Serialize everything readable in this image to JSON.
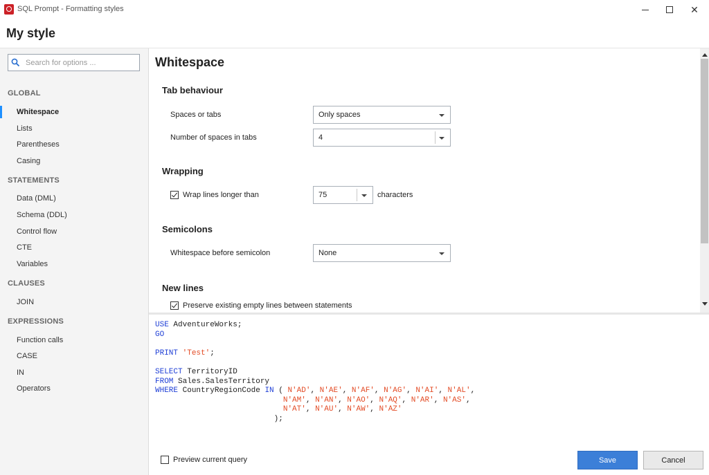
{
  "window": {
    "title": "SQL Prompt - Formatting styles",
    "icon": "sql-prompt-app-icon"
  },
  "header": {
    "style_name": "My style"
  },
  "sidebar": {
    "search_placeholder": "Search for options ...",
    "sections": [
      {
        "label": "GLOBAL",
        "items": [
          "Whitespace",
          "Lists",
          "Parentheses",
          "Casing"
        ]
      },
      {
        "label": "STATEMENTS",
        "items": [
          "Data (DML)",
          "Schema (DDL)",
          "Control flow",
          "CTE",
          "Variables"
        ]
      },
      {
        "label": "CLAUSES",
        "items": [
          "JOIN"
        ]
      },
      {
        "label": "EXPRESSIONS",
        "items": [
          "Function calls",
          "CASE",
          "IN",
          "Operators"
        ]
      }
    ],
    "active_item": "Whitespace"
  },
  "main": {
    "heading": "Whitespace",
    "tab_behaviour": {
      "heading": "Tab behaviour",
      "spaces_or_tabs_label": "Spaces or tabs",
      "spaces_or_tabs_value": "Only spaces",
      "num_spaces_label": "Number of spaces in tabs",
      "num_spaces_value": "4"
    },
    "wrapping": {
      "heading": "Wrapping",
      "wrap_label": "Wrap lines longer than",
      "wrap_checked": true,
      "wrap_value": "75",
      "wrap_suffix": "characters"
    },
    "semicolons": {
      "heading": "Semicolons",
      "label": "Whitespace before semicolon",
      "value": "None"
    },
    "new_lines": {
      "heading": "New lines",
      "preserve_label": "Preserve existing empty lines between statements",
      "preserve_checked": true
    }
  },
  "preview": {
    "lines": [
      [
        {
          "t": "USE",
          "c": "kw"
        },
        {
          "t": " AdventureWorks;",
          "c": ""
        }
      ],
      [
        {
          "t": "GO",
          "c": "kw"
        }
      ],
      [],
      [
        {
          "t": "PRINT",
          "c": "kw"
        },
        {
          "t": " ",
          "c": ""
        },
        {
          "t": "'Test'",
          "c": "str"
        },
        {
          "t": ";",
          "c": ""
        }
      ],
      [],
      [
        {
          "t": "SELECT",
          "c": "kw"
        },
        {
          "t": " TerritoryID",
          "c": ""
        }
      ],
      [
        {
          "t": "FROM",
          "c": "kw"
        },
        {
          "t": " Sales.SalesTerritory",
          "c": ""
        }
      ],
      [
        {
          "t": "WHERE",
          "c": "kw"
        },
        {
          "t": " CountryRegionCode ",
          "c": ""
        },
        {
          "t": "IN",
          "c": "kw"
        },
        {
          "t": " ( ",
          "c": ""
        },
        {
          "t": "N'AD'",
          "c": "str"
        },
        {
          "t": ", ",
          "c": ""
        },
        {
          "t": "N'AE'",
          "c": "str"
        },
        {
          "t": ", ",
          "c": ""
        },
        {
          "t": "N'AF'",
          "c": "str"
        },
        {
          "t": ", ",
          "c": ""
        },
        {
          "t": "N'AG'",
          "c": "str"
        },
        {
          "t": ", ",
          "c": ""
        },
        {
          "t": "N'AI'",
          "c": "str"
        },
        {
          "t": ", ",
          "c": ""
        },
        {
          "t": "N'AL'",
          "c": "str"
        },
        {
          "t": ",",
          "c": ""
        }
      ],
      [
        {
          "t": "                            ",
          "c": ""
        },
        {
          "t": "N'AM'",
          "c": "str"
        },
        {
          "t": ", ",
          "c": ""
        },
        {
          "t": "N'AN'",
          "c": "str"
        },
        {
          "t": ", ",
          "c": ""
        },
        {
          "t": "N'AO'",
          "c": "str"
        },
        {
          "t": ", ",
          "c": ""
        },
        {
          "t": "N'AQ'",
          "c": "str"
        },
        {
          "t": ", ",
          "c": ""
        },
        {
          "t": "N'AR'",
          "c": "str"
        },
        {
          "t": ", ",
          "c": ""
        },
        {
          "t": "N'AS'",
          "c": "str"
        },
        {
          "t": ",",
          "c": ""
        }
      ],
      [
        {
          "t": "                            ",
          "c": ""
        },
        {
          "t": "N'AT'",
          "c": "str"
        },
        {
          "t": ", ",
          "c": ""
        },
        {
          "t": "N'AU'",
          "c": "str"
        },
        {
          "t": ", ",
          "c": ""
        },
        {
          "t": "N'AW'",
          "c": "str"
        },
        {
          "t": ", ",
          "c": ""
        },
        {
          "t": "N'AZ'",
          "c": "str"
        }
      ],
      [
        {
          "t": "                          );",
          "c": ""
        }
      ]
    ]
  },
  "footer": {
    "preview_query_label": "Preview current query",
    "preview_query_checked": false,
    "save_label": "Save",
    "cancel_label": "Cancel"
  },
  "colors": {
    "accent": "#1e90ff",
    "save_button": "#3c7fd8",
    "sql_keyword": "#1f3fd6",
    "sql_string": "#e34c26"
  }
}
